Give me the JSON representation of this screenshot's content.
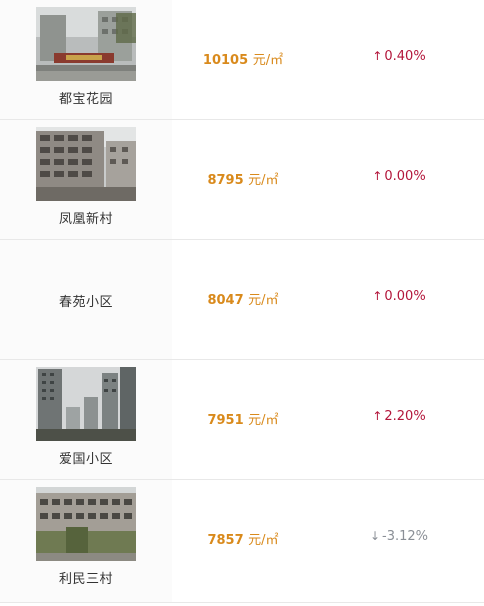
{
  "unit": "元/㎡",
  "colors": {
    "price": "#d98a1c",
    "rise": "#b3163b",
    "fall": "#8a8f96"
  },
  "rows": [
    {
      "name": "都宝花园",
      "price": "10105",
      "change": "0.40%",
      "direction": "up",
      "photo": "gate-photo"
    },
    {
      "name": "凤凰新村",
      "price": "8795",
      "change": "0.00%",
      "direction": "up",
      "photo": "apartment-photo"
    },
    {
      "name": "春苑小区",
      "price": "8047",
      "change": "0.00%",
      "direction": "up",
      "photo": ""
    },
    {
      "name": "爱国小区",
      "price": "7951",
      "change": "2.20%",
      "direction": "up",
      "photo": "towers-photo"
    },
    {
      "name": "利民三村",
      "price": "7857",
      "change": "-3.12%",
      "direction": "down",
      "photo": "building-photo"
    }
  ],
  "icons": {
    "up": "arrow-up-icon",
    "down": "arrow-down-icon"
  }
}
